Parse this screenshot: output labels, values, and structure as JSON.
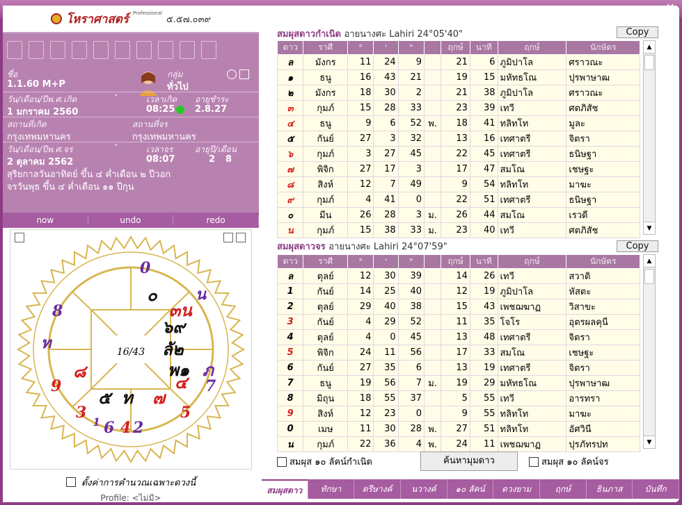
{
  "app": {
    "brand": "โหราศาสตร์",
    "brand_pro": "Professional",
    "version": "๕.๕๗.๐๓๙",
    "window_buttons": [
      "–",
      "×"
    ]
  },
  "info": {
    "name_label": "ชื่อ",
    "name": "1.1.60 M+P",
    "group_label": "กลุ่ม",
    "group": "ทั่วไป",
    "birth_date_label": "วัน/เดือน/ปีพ.ศ.เกิด",
    "birth_date": "1 มกราคม 2560",
    "birth_time_label": "เวลาเกิด",
    "birth_time": "08:25",
    "age_label": "อายุชำระ",
    "age": "2.8.27",
    "birth_place_label": "สถานที่เกิด",
    "birth_place": "กรุงเทพมหานคร",
    "current_place_label": "สถานที่จร",
    "current_place": "กรุงเทพมหานคร",
    "transit_date_label": "วัน/เดือน/ปีพ.ศ.จร",
    "transit_date": "2 ตุลาคม 2562",
    "transit_time_label": "เวลาจร",
    "transit_time": "08:07",
    "age_years_label": "อายุปี/เดือน",
    "age_years": "2",
    "age_months": "8",
    "line1": "สุริยกาลวันอาทิตย์ ขึ้น ๔ ค่ำเดือน ๒ ปีวอก",
    "line2": "จรวันพุธ ขึ้น ๔ ค่ำเดือน ๑๑ ปีกุน"
  },
  "nav": {
    "now": "now",
    "undo": "undo",
    "redo": "redo"
  },
  "chart_wheel": {
    "center": "16/43",
    "outer_labels": [
      "0",
      "น",
      "8",
      "ท",
      "9",
      "3",
      "1",
      "6",
      "4",
      "2",
      "5",
      "7"
    ],
    "inner_labels": [
      "๐",
      "๓น",
      "๖๙ ",
      "ลั๒",
      "พ๑",
      "ภ",
      "๕",
      "ท",
      "๗",
      "๘",
      "๔"
    ]
  },
  "footer": {
    "checkbox_label": "ตั้งค่าการคำนวณเฉพาะดวงนี้",
    "profile": "Profile: <ไม่มี>"
  },
  "natal": {
    "title": "สมผุสดาวกำเนิด",
    "ayanamsa": "อายนางศะ Lahiri  24°05'40\"",
    "copy": "Copy",
    "headers": [
      "ดาว",
      "ราศี",
      "°",
      "'",
      "\"",
      "",
      "ฤกษ์",
      "นาที",
      "ฤกษ์",
      "นักษัตร"
    ],
    "rows": [
      [
        "ล",
        "มังกร",
        "11",
        "24",
        "9",
        "",
        "21",
        "6",
        "ภูมิปาโล",
        "ศราวณะ"
      ],
      [
        "๑",
        "ธนู",
        "16",
        "43",
        "21",
        "",
        "19",
        "15",
        "มหัทธโณ",
        "ปุรพาษาฒ"
      ],
      [
        "๒",
        "มังกร",
        "18",
        "30",
        "2",
        "",
        "21",
        "38",
        "ภูมิปาโล",
        "ศราวณะ"
      ],
      [
        "๓",
        "กุมภ์",
        "15",
        "28",
        "33",
        "",
        "23",
        "39",
        "เทวี",
        "ศตภิสัช"
      ],
      [
        "๔",
        "ธนู",
        "9",
        "6",
        "52",
        "พ.",
        "18",
        "41",
        "ทลิทโท",
        "มูละ"
      ],
      [
        "๕",
        "กันย์",
        "27",
        "3",
        "32",
        "",
        "13",
        "16",
        "เทศาตรี",
        "จิตรา"
      ],
      [
        "๖",
        "กุมภ์",
        "3",
        "27",
        "45",
        "",
        "22",
        "45",
        "เทศาตรี",
        "ธนิษฐา"
      ],
      [
        "๗",
        "พิจิก",
        "27",
        "17",
        "3",
        "",
        "17",
        "47",
        "สมโณ",
        "เชษฐะ"
      ],
      [
        "๘",
        "สิงห์",
        "12",
        "7",
        "49",
        "",
        "9",
        "54",
        "ทลิทโท",
        "มาฆะ"
      ],
      [
        "๙",
        "กุมภ์",
        "4",
        "41",
        "0",
        "",
        "22",
        "51",
        "เทศาตรี",
        "ธนิษฐา"
      ],
      [
        "๐",
        "มีน",
        "26",
        "28",
        "3",
        "ม.",
        "26",
        "44",
        "สมโณ",
        "เรวดี"
      ],
      [
        "น",
        "กุมภ์",
        "15",
        "38",
        "33",
        "ม.",
        "23",
        "40",
        "เทวี",
        "ศตภิสัช"
      ]
    ]
  },
  "transit": {
    "title": "สมผุสดาวจร",
    "ayanamsa": "อายนางศะ Lahiri  24°07'59\"",
    "copy": "Copy",
    "headers": [
      "ดาว",
      "ราศี",
      "°",
      "'",
      "\"",
      "",
      "ฤกษ์",
      "นาที",
      "ฤกษ์",
      "นักษัตร"
    ],
    "rows": [
      [
        "ล",
        "ตุลย์",
        "12",
        "30",
        "39",
        "",
        "14",
        "26",
        "เทวี",
        "สวาติ"
      ],
      [
        "1",
        "กันย์",
        "14",
        "25",
        "40",
        "",
        "12",
        "19",
        "ภูมิปาโล",
        "หัสตะ"
      ],
      [
        "2",
        "ตุลย์",
        "29",
        "40",
        "38",
        "",
        "15",
        "43",
        "เพชฌฆาฏ",
        "วิสาขะ"
      ],
      [
        "3",
        "กันย์",
        "4",
        "29",
        "52",
        "",
        "11",
        "35",
        "โจโร",
        "อุตรผลคุนี"
      ],
      [
        "4",
        "ตุลย์",
        "4",
        "0",
        "45",
        "",
        "13",
        "48",
        "เทศาตรี",
        "จิตรา"
      ],
      [
        "5",
        "พิจิก",
        "24",
        "11",
        "56",
        "",
        "17",
        "33",
        "สมโณ",
        "เชษฐะ"
      ],
      [
        "6",
        "กันย์",
        "27",
        "35",
        "6",
        "",
        "13",
        "19",
        "เทศาตรี",
        "จิตรา"
      ],
      [
        "7",
        "ธนู",
        "19",
        "56",
        "7",
        "ม.",
        "19",
        "29",
        "มหัทธโณ",
        "ปุรพาษาฒ"
      ],
      [
        "8",
        "มิถุน",
        "18",
        "55",
        "37",
        "",
        "5",
        "55",
        "เทวี",
        "อารทรา"
      ],
      [
        "9",
        "สิงห์",
        "12",
        "23",
        "0",
        "",
        "9",
        "55",
        "ทลิทโท",
        "มาฆะ"
      ],
      [
        "0",
        "เมษ",
        "11",
        "30",
        "28",
        "พ.",
        "27",
        "51",
        "ทลิทโท",
        "อัศวินี"
      ],
      [
        "น",
        "กุมภ์",
        "22",
        "36",
        "4",
        "พ.",
        "24",
        "11",
        "เพชฌฆาฏ",
        "ปุรภัทรปท"
      ]
    ]
  },
  "controls": {
    "natal10": "สมผุส ๑๐ ลัคน์กำเนิด",
    "search": "ค้นหามุมดาว",
    "transit10": "สมผุส ๑๐ ลัคน์จร"
  },
  "tabs": [
    "สมผุสดาว",
    "ทักษา",
    "ตรีษางค์",
    "นวางค์",
    "๑๐ ลัคน์",
    "ดวงยาม",
    "ฤกษ์",
    "ธินภาส",
    "บันทึก"
  ],
  "colors": {
    "purple": "#8d3c85",
    "panel": "#b882b0",
    "header": "#a878a2",
    "cell": "#fffde8",
    "red": "#d42020",
    "green": "#22cc22"
  }
}
